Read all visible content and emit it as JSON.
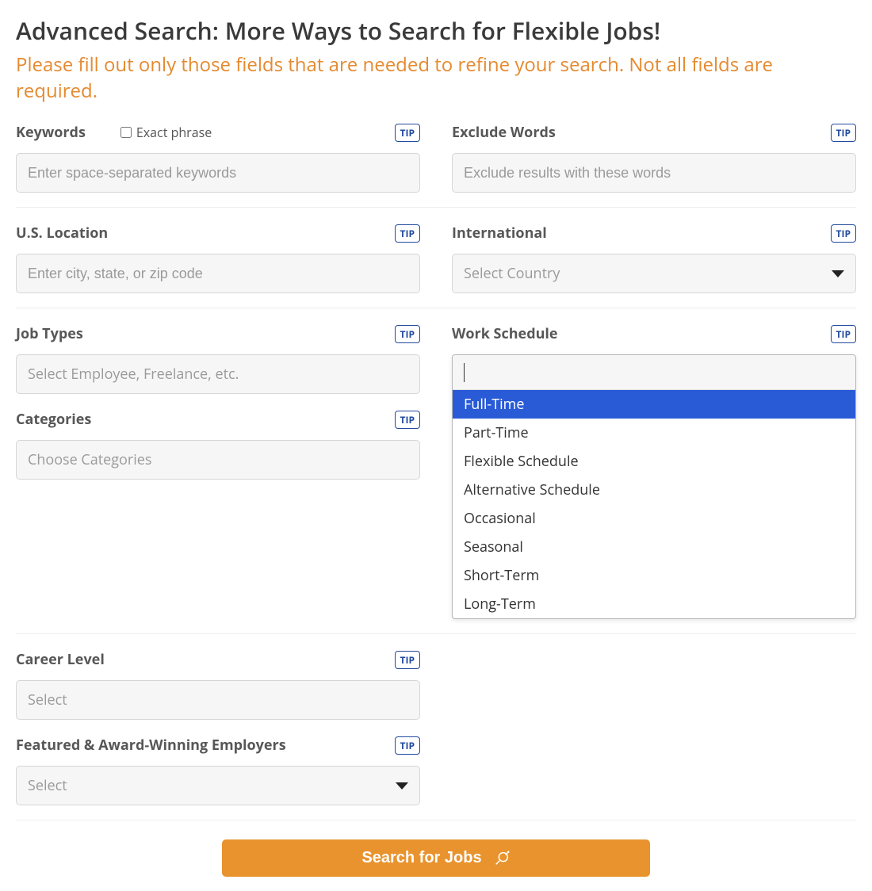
{
  "header": {
    "title": "Advanced Search: More Ways to Search for Flexible Jobs!",
    "subtitle": "Please fill out only those fields that are needed to refine your search. Not all fields are required."
  },
  "tip_label": "TIP",
  "keywords": {
    "label": "Keywords",
    "exact_phrase_label": "Exact phrase",
    "placeholder": "Enter space-separated keywords"
  },
  "exclude": {
    "label": "Exclude Words",
    "placeholder": "Exclude results with these words"
  },
  "us_location": {
    "label": "U.S. Location",
    "placeholder": "Enter city, state, or zip code"
  },
  "international": {
    "label": "International",
    "placeholder": "Select Country"
  },
  "job_types": {
    "label": "Job Types",
    "placeholder": "Select Employee, Freelance, etc."
  },
  "categories": {
    "label": "Categories",
    "placeholder": "Choose Categories"
  },
  "work_schedule": {
    "label": "Work Schedule",
    "options": [
      "Full-Time",
      "Part-Time",
      "Flexible Schedule",
      "Alternative Schedule",
      "Occasional",
      "Seasonal",
      "Short-Term",
      "Long-Term"
    ],
    "highlighted_index": 0
  },
  "career_level": {
    "label": "Career Level",
    "placeholder": "Select"
  },
  "featured": {
    "label": "Featured & Award-Winning Employers",
    "placeholder": "Select"
  },
  "search_button": "Search for Jobs"
}
